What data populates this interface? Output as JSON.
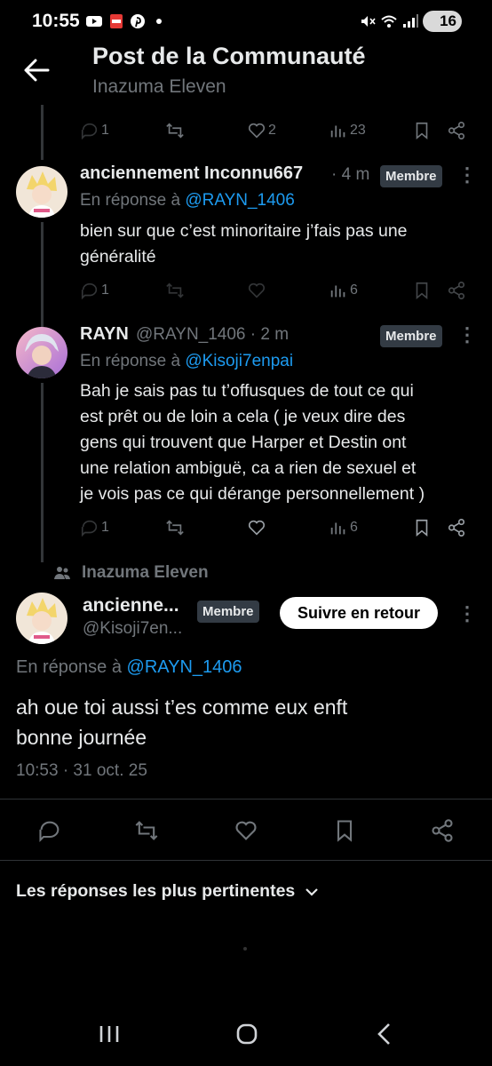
{
  "status_bar": {
    "time": "10:55",
    "battery": "16"
  },
  "header": {
    "title": "Post de la Communauté",
    "subtitle": "Inazuma Eleven"
  },
  "top_actions": {
    "replies": "1",
    "likes": "2",
    "views": "23"
  },
  "tweet1": {
    "name": "anciennement Inconnu667",
    "time": "· 4 m",
    "badge": "Membre",
    "reply_prefix": "En réponse à ",
    "reply_handle": "@RAYN_1406",
    "text_line1": "bien sur que c’est minoritaire j’fais pas une",
    "text_line2": "généralité",
    "replies": "1",
    "views": "6"
  },
  "tweet2": {
    "name": "RAYN",
    "handle_time": "@RAYN_1406 · 2 m",
    "badge": "Membre",
    "reply_prefix": "En réponse à ",
    "reply_handle": "@Kisoji7enpai",
    "text_lines": [
      "Bah je sais pas tu t’offusques de tout ce qui",
      "est prêt ou de loin a cela ( je veux dire des",
      "gens qui trouvent que Harper et Destin ont",
      "une relation ambiguë,  ca a rien de sexuel et",
      "je vois pas ce qui dérange personnellement )"
    ],
    "replies": "1",
    "views": "6"
  },
  "focus": {
    "community": "Inazuma Eleven",
    "name": "ancienne...",
    "handle": "@Kisoji7en...",
    "badge": "Membre",
    "follow_label": "Suivre en retour",
    "reply_prefix": "En réponse à ",
    "reply_handle": "@RAYN_1406",
    "text_line1": "ah oue toi aussi t’es comme eux enft",
    "text_line2": "bonne journée",
    "timestamp": "10:53 · 31 oct. 25"
  },
  "sort_label": "Les réponses les plus pertinentes",
  "colors": {
    "accent": "#1d9bf0",
    "muted": "#71767b",
    "background": "#000000"
  }
}
